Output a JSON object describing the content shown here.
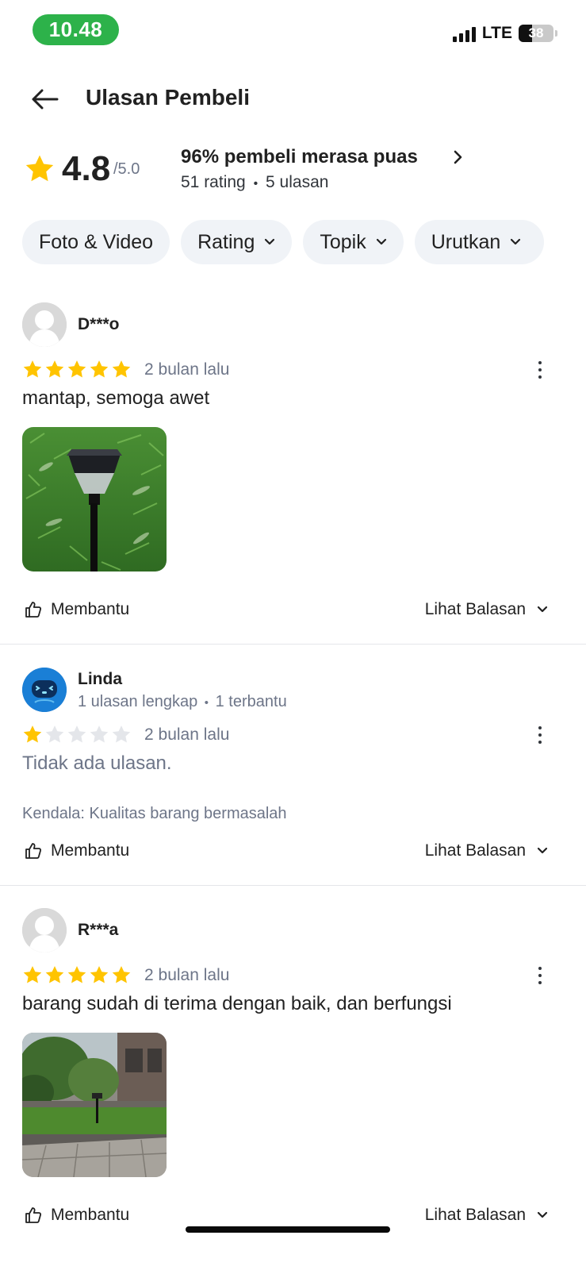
{
  "status_bar": {
    "time": "10.48",
    "network": "LTE",
    "battery": "38"
  },
  "header": {
    "title": "Ulasan Pembeli"
  },
  "summary": {
    "score": "4.8",
    "max": "/5.0",
    "satisfied": "96% pembeli merasa puas",
    "rating_count": "51 rating",
    "separator": "•",
    "review_count": "5 ulasan"
  },
  "filters": [
    {
      "label": "Foto & Video"
    },
    {
      "label": "Rating"
    },
    {
      "label": "Topik"
    },
    {
      "label": "Urutkan"
    }
  ],
  "reviews": [
    {
      "name": "D***o",
      "stars": 5,
      "time": "2 bulan lalu",
      "text": "mantap, semoga awet",
      "helpful": "Membantu",
      "see_reply": "Lihat Balasan"
    },
    {
      "name": "Linda",
      "sub_left": "1 ulasan lengkap",
      "sub_sep": "•",
      "sub_right": "1 terbantu",
      "stars": 1,
      "time": "2 bulan lalu",
      "text": "Tidak ada ulasan.",
      "kendala": "Kendala: Kualitas barang bermasalah",
      "helpful": "Membantu",
      "see_reply": "Lihat Balasan"
    },
    {
      "name": "R***a",
      "stars": 5,
      "time": "2 bulan lalu",
      "text": "barang sudah di terima dengan baik, dan berfungsi",
      "helpful": "Membantu",
      "see_reply": "Lihat Balasan"
    }
  ],
  "colors": {
    "star": "#ffc400",
    "star_empty": "#e4e6ea",
    "time_pill": "#2db24a",
    "accent_text": "#212121",
    "muted_text": "#6d7588"
  }
}
